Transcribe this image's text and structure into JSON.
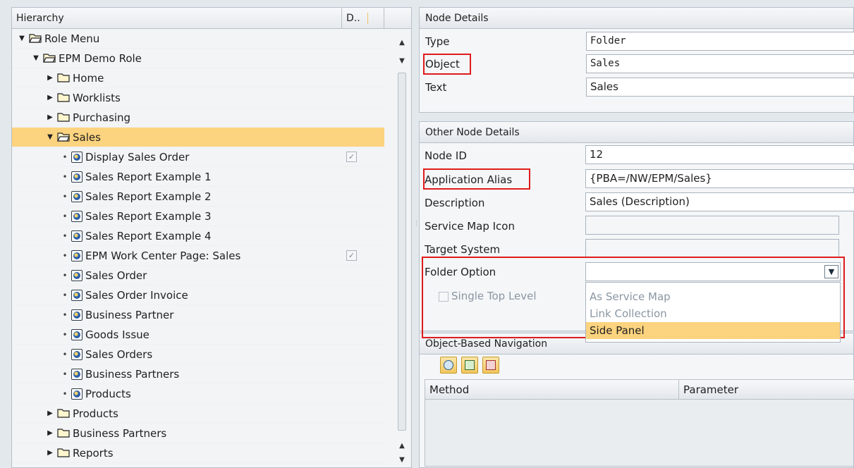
{
  "tree": {
    "header_hierarchy": "Hierarchy",
    "header_d": "D..",
    "rows": [
      {
        "label": "Role Menu",
        "level": 0,
        "kind": "folder",
        "toggle": "▼",
        "open": true
      },
      {
        "label": "EPM Demo Role",
        "level": 1,
        "kind": "folder",
        "toggle": "▼",
        "open": true
      },
      {
        "label": "Home",
        "level": 2,
        "kind": "folder",
        "toggle": "▶"
      },
      {
        "label": "Worklists",
        "level": 2,
        "kind": "folder",
        "toggle": "▶"
      },
      {
        "label": "Purchasing",
        "level": 2,
        "kind": "folder",
        "toggle": "▶"
      },
      {
        "label": "Sales",
        "level": 2,
        "kind": "folder",
        "toggle": "▼",
        "open": true,
        "selected": true
      },
      {
        "label": "Display Sales Order",
        "level": 3,
        "kind": "app",
        "checked": true
      },
      {
        "label": "Sales Report Example 1",
        "level": 3,
        "kind": "app"
      },
      {
        "label": "Sales Report Example 2",
        "level": 3,
        "kind": "app"
      },
      {
        "label": "Sales Report Example 3",
        "level": 3,
        "kind": "app"
      },
      {
        "label": "Sales Report Example 4",
        "level": 3,
        "kind": "app"
      },
      {
        "label": "EPM Work Center Page: Sales",
        "level": 3,
        "kind": "app",
        "checked": true
      },
      {
        "label": "Sales Order",
        "level": 3,
        "kind": "app"
      },
      {
        "label": "Sales Order Invoice",
        "level": 3,
        "kind": "app"
      },
      {
        "label": "Business Partner",
        "level": 3,
        "kind": "app"
      },
      {
        "label": "Goods Issue",
        "level": 3,
        "kind": "app"
      },
      {
        "label": "Sales Orders",
        "level": 3,
        "kind": "app"
      },
      {
        "label": "Business Partners",
        "level": 3,
        "kind": "app"
      },
      {
        "label": "Products",
        "level": 3,
        "kind": "app"
      },
      {
        "label": "Products",
        "level": 2,
        "kind": "folder",
        "toggle": "▶"
      },
      {
        "label": "Business Partners",
        "level": 2,
        "kind": "folder",
        "toggle": "▶"
      },
      {
        "label": "Reports",
        "level": 2,
        "kind": "folder",
        "toggle": "▶"
      }
    ]
  },
  "node_details": {
    "title": "Node Details",
    "type_label": "Type",
    "type_value": "Folder",
    "object_label": "Object",
    "object_value": "Sales",
    "text_label": "Text",
    "text_value": "Sales"
  },
  "other_details": {
    "title": "Other Node Details",
    "node_id_label": "Node ID",
    "node_id_value": "12",
    "alias_label": "Application Alias",
    "alias_value": "{PBA=/NW/EPM/Sales}",
    "description_label": "Description",
    "description_value": "Sales (Description)",
    "service_map_icon_label": "Service Map Icon",
    "service_map_icon_value": "",
    "target_system_label": "Target System",
    "target_system_value": "",
    "folder_option_label": "Folder Option",
    "folder_option_value": "",
    "folder_options": [
      "As Service Map",
      "Link Collection",
      "Side Panel"
    ],
    "folder_option_highlighted": "Side Panel",
    "single_top_level_label": "Single Top Level"
  },
  "obn": {
    "title": "Object-Based Navigation",
    "col_method": "Method",
    "col_parameter": "Parameter"
  },
  "colors": {
    "selection": "#fcd37e",
    "highlight_box": "#e01b1b",
    "disabled_text": "#8a96a2"
  }
}
